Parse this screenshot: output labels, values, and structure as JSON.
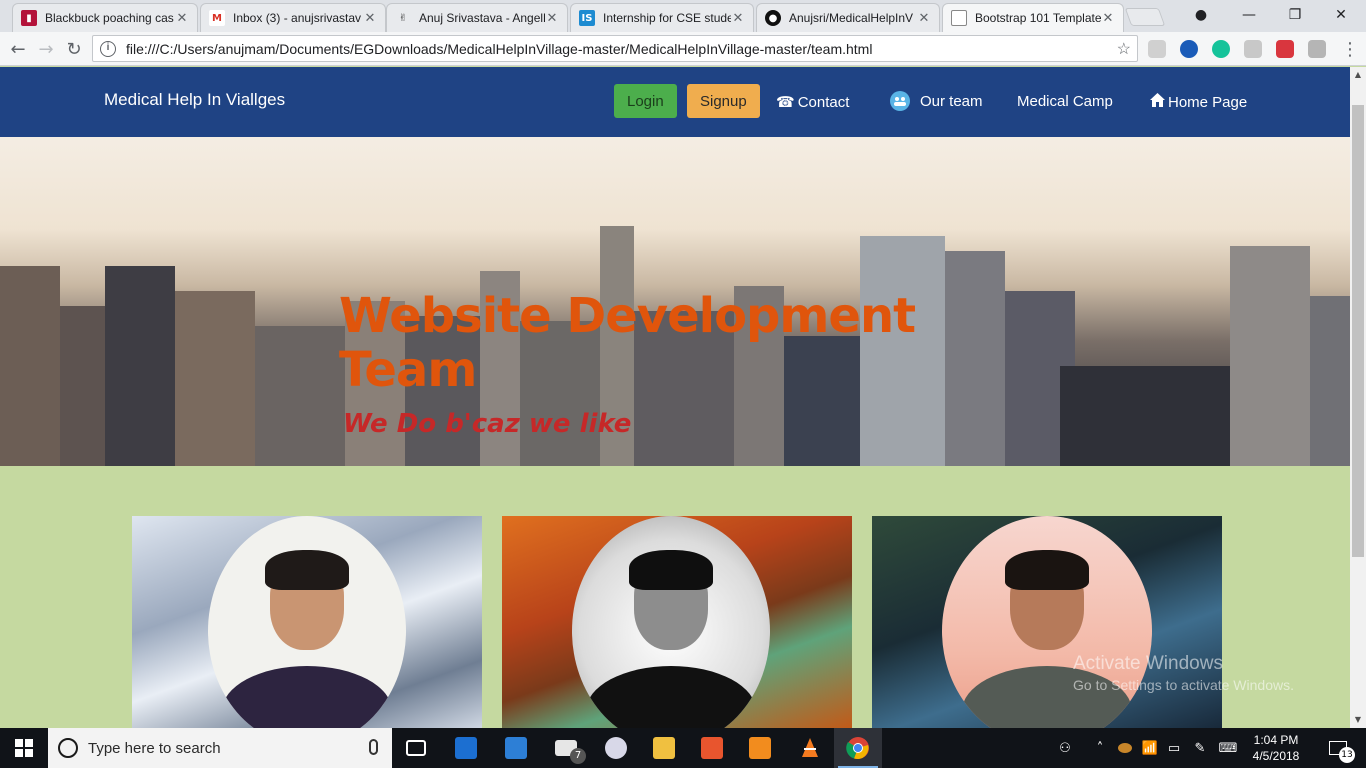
{
  "browser": {
    "tabs": [
      {
        "title": "Blackbuck poaching cas",
        "favicon": "bookmark-icon",
        "color": "#b3123a"
      },
      {
        "title": "Inbox (3) - anujsrivastav",
        "favicon": "gmail-icon",
        "color": "#d93025"
      },
      {
        "title": "Anuj Srivastava - Angell",
        "favicon": "angellist-icon",
        "color": "#333333"
      },
      {
        "title": "Internship for CSE stude",
        "favicon": "internshala-icon",
        "color": "#1d8bd1"
      },
      {
        "title": "Anujsri/MedicalHelpInV",
        "favicon": "github-icon",
        "color": "#111111"
      },
      {
        "title": "Bootstrap 101 Template",
        "favicon": "page-icon",
        "color": "#ffffff"
      }
    ],
    "url": "file:///C:/Users/anujmam/Documents/EGDownloads/MedicalHelpInVillage-master/MedicalHelpInVillage-master/team.html"
  },
  "site": {
    "brand": "Medical Help In Viallges",
    "login": "Login",
    "signup": "Signup",
    "nav": [
      {
        "label": "Contact",
        "icon": "phone-icon"
      },
      {
        "label": "Our team",
        "icon": "team-icon"
      },
      {
        "label": "Medical Camp",
        "icon": ""
      },
      {
        "label": "Home Page",
        "icon": "home-icon"
      }
    ],
    "hero": {
      "title": "Website Development Team",
      "tagline": "We Do b'caz we like"
    },
    "team": [
      {
        "background": "snowy-mountains",
        "bg_color": "#b8c4d6"
      },
      {
        "background": "autumn-forest",
        "bg_color": "#c4581c"
      },
      {
        "background": "waterfall",
        "bg_color": "#1f3b43"
      }
    ]
  },
  "watermark": {
    "line1": "Activate Windows",
    "line2": "Go to Settings to activate Windows."
  },
  "taskbar": {
    "search_placeholder": "Type here to search",
    "mail_badge": "7",
    "time": "1:04 PM",
    "date": "4/5/2018",
    "notifications": "13"
  }
}
